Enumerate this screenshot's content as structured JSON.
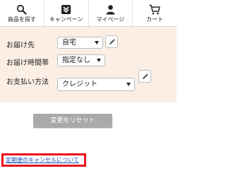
{
  "nav": {
    "items": [
      {
        "label": "商品を探す",
        "icon": "search-icon"
      },
      {
        "label": "キャンペーン",
        "icon": "campaign-down-arrow-icon"
      },
      {
        "label": "マイページ",
        "icon": "user-icon"
      },
      {
        "label": "カート",
        "icon": "cart-icon"
      }
    ]
  },
  "form": {
    "delivery_to_label": "お届け先",
    "delivery_to_value": "自宅",
    "delivery_time_label": "お届け時間帯",
    "delivery_time_value": "指定なし",
    "payment_label": "お支払い方法",
    "payment_value": "クレジット"
  },
  "reset_button_label": "変更をリセット",
  "cancel_link_label": "定期便のキャンセルについて",
  "colors": {
    "panel_bg": "#fbeee4",
    "reset_btn_bg": "#a9a9a9",
    "highlight_border": "#e8121b",
    "link": "#1a4fb8"
  }
}
